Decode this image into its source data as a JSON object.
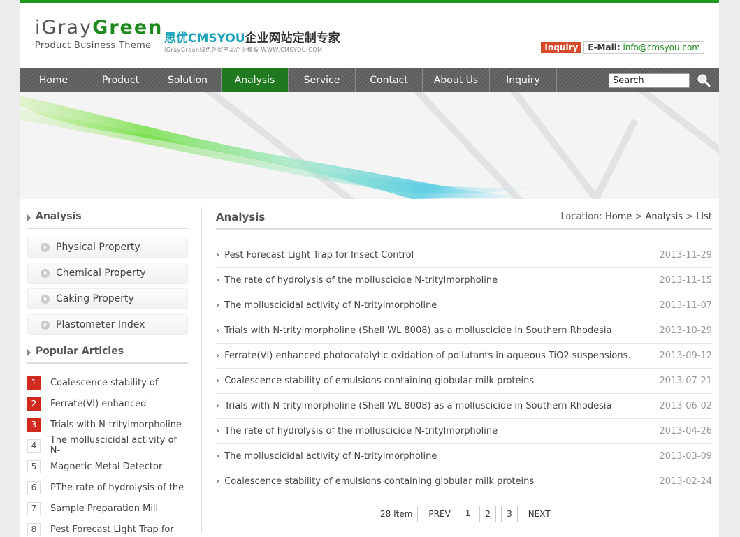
{
  "header": {
    "logo_text_gray": "iGray",
    "logo_text_green": "Green",
    "logo_sub": "Product Business Theme",
    "brand_prefix": "思优",
    "brand_highlight": "CMSYOU",
    "brand_suffix": "企业网站定制专家",
    "brand_sub": "iGrayGreen绿色外贸产品企业模板   WWW.CMSYOU.COM",
    "inquiry_badge": "Inquiry",
    "email_label": "E-Mail:",
    "email_value": "info@cmsyou.com"
  },
  "nav": {
    "items": [
      {
        "label": "Home",
        "active": false
      },
      {
        "label": "Product",
        "active": false
      },
      {
        "label": "Solution",
        "active": false
      },
      {
        "label": "Analysis",
        "active": true
      },
      {
        "label": "Service",
        "active": false
      },
      {
        "label": "Contact",
        "active": false
      },
      {
        "label": "About Us",
        "active": false
      },
      {
        "label": "Inquiry",
        "active": false
      }
    ],
    "search_value": "Search"
  },
  "sidebar": {
    "title": "Analysis",
    "categories": [
      "Physical Property",
      "Chemical Property",
      "Caking Property",
      "Plastometer Index"
    ],
    "popular_title": "Popular Articles",
    "popular": [
      {
        "num": "1",
        "title": "Coalescence stability of",
        "hot": true
      },
      {
        "num": "2",
        "title": "Ferrate(VI) enhanced",
        "hot": true
      },
      {
        "num": "3",
        "title": "Trials with N-tritylmorpholine",
        "hot": true
      },
      {
        "num": "4",
        "title": "The molluscicidal activity of N-",
        "hot": false
      },
      {
        "num": "5",
        "title": "Magnetic Metal Detector",
        "hot": false
      },
      {
        "num": "6",
        "title": "PThe rate of hydrolysis of the",
        "hot": false
      },
      {
        "num": "7",
        "title": "Sample Preparation Mill",
        "hot": false
      },
      {
        "num": "8",
        "title": "Pest Forecast Light Trap for",
        "hot": false
      }
    ]
  },
  "main": {
    "title": "Analysis",
    "location_label": "Location:",
    "crumb_home": "Home",
    "crumb_sep1": ">",
    "crumb_section": "Analysis",
    "crumb_sep2": ">",
    "crumb_page": "List",
    "articles": [
      {
        "title": "Pest Forecast Light Trap for Insect Control",
        "date": "2013-11-29"
      },
      {
        "title": "The rate of hydrolysis of the molluscicide N-tritylmorpholine",
        "date": "2013-11-15"
      },
      {
        "title": "The molluscicidal activity of N-tritylmorpholine",
        "date": "2013-11-07"
      },
      {
        "title": "Trials with N-tritylmorpholine (Shell WL 8008) as a molluscicide in Southern Rhodesia",
        "date": "2013-10-29"
      },
      {
        "title": "Ferrate(VI) enhanced photocatalytic oxidation of pollutants in aqueous TiO2 suspensions.",
        "date": "2013-09-12"
      },
      {
        "title": "Coalescence stability of emulsions containing globular milk proteins",
        "date": "2013-07-21"
      },
      {
        "title": "Trials with N-tritylmorpholine (Shell WL 8008) as a molluscicide in Southern Rhodesia",
        "date": "2013-06-02"
      },
      {
        "title": "The rate of hydrolysis of the molluscicide N-tritylmorpholine",
        "date": "2013-04-26"
      },
      {
        "title": "The molluscicidal activity of N-tritylmorpholine",
        "date": "2013-03-09"
      },
      {
        "title": "Coalescence stability of emulsions containing globular milk proteins",
        "date": "2013-02-24"
      }
    ],
    "pager": {
      "count": "28 Item",
      "prev": "PREV",
      "current": "1",
      "pages": [
        "2",
        "3"
      ],
      "next": "NEXT"
    }
  },
  "colors": {
    "accent_green": "#1f7a1f",
    "hot_red": "#d02a1f",
    "inquiry_red": "#d64a2a"
  }
}
